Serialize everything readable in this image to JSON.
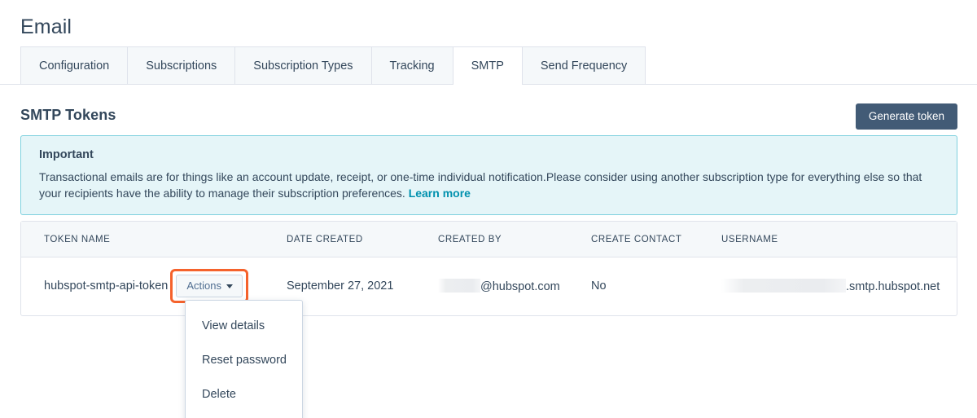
{
  "page": {
    "title": "Email"
  },
  "tabs": [
    {
      "label": "Configuration",
      "active": false
    },
    {
      "label": "Subscriptions",
      "active": false
    },
    {
      "label": "Subscription Types",
      "active": false
    },
    {
      "label": "Tracking",
      "active": false
    },
    {
      "label": "SMTP",
      "active": true
    },
    {
      "label": "Send Frequency",
      "active": false
    }
  ],
  "section": {
    "title": "SMTP Tokens",
    "generate_button": "Generate token"
  },
  "alert": {
    "title": "Important",
    "body": "Transactional emails are for things like an account update, receipt, or one-time individual notification.Please consider using another subscription type for everything else so that your recipients have the ability to manage their subscription preferences. ",
    "link": "Learn more",
    "border_color": "#7fd1de",
    "background_color": "#e5f5f8",
    "link_color": "#0091ae"
  },
  "table": {
    "headers": [
      "TOKEN NAME",
      "DATE CREATED",
      "CREATED BY",
      "CREATE CONTACT",
      "USERNAME"
    ],
    "rows": [
      {
        "token_name": "hubspot-smtp-api-token",
        "actions_label": "Actions",
        "date_created": "September 27, 2021",
        "created_by_redacted": true,
        "created_by_suffix": "@hubspot.com",
        "create_contact": "No",
        "username_redacted": true,
        "username_suffix": ".smtp.hubspot.net"
      }
    ]
  },
  "dropdown": {
    "open": true,
    "items": [
      "View details",
      "Reset password",
      "Delete"
    ]
  },
  "highlight": {
    "target": "actions-button",
    "color": "#f5622c"
  }
}
